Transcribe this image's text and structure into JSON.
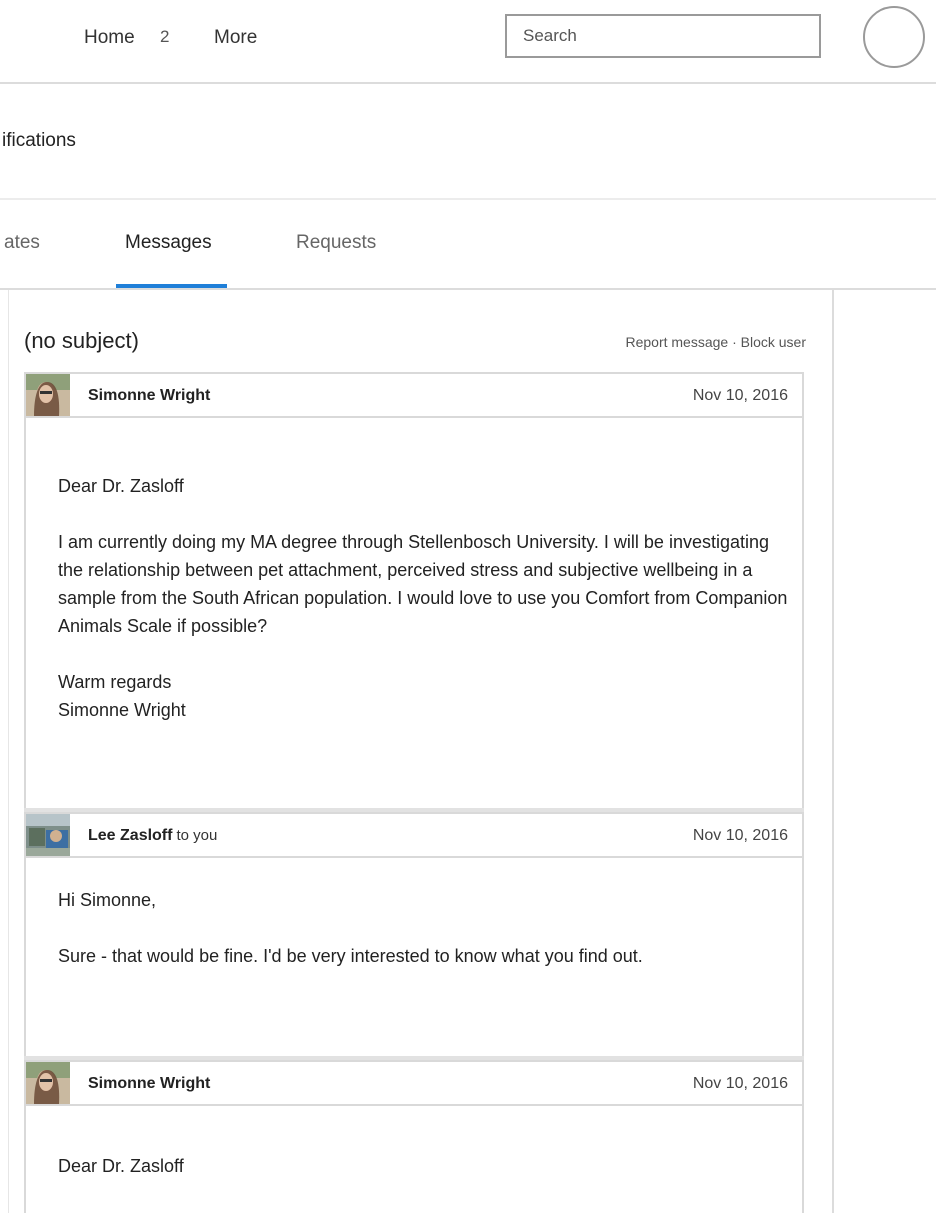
{
  "nav": {
    "home": "Home",
    "badge": "2",
    "more": "More",
    "search_placeholder": "Search"
  },
  "section": {
    "title": "ifications"
  },
  "tabs": [
    {
      "label": "ates"
    },
    {
      "label": "Messages"
    },
    {
      "label": "Requests"
    }
  ],
  "conversation": {
    "subject": "(no subject)",
    "report_label": "Report message",
    "separator": "·",
    "block_label": "Block user",
    "messages": [
      {
        "sender": "Simonne Wright",
        "recipient": "",
        "date": "Nov 10, 2016",
        "lines": [
          "Dear Dr. Zasloff",
          "",
          "I am currently doing my MA degree through Stellenbosch University. I will be investigating the relationship between pet attachment, perceived stress and subjective wellbeing in a sample from the South African population. I would love to use you Comfort from Companion Animals Scale if possible?",
          "",
          "Warm regards",
          "Simonne Wright"
        ]
      },
      {
        "sender": "Lee Zasloff",
        "recipient": "to you",
        "date": "Nov 10, 2016",
        "lines": [
          "Hi Simonne,",
          "",
          "Sure - that would be fine. I'd be very interested to know what you find out."
        ]
      },
      {
        "sender": "Simonne Wright",
        "recipient": "",
        "date": "Nov 10, 2016",
        "lines": [
          "Dear Dr. Zasloff"
        ]
      }
    ]
  }
}
